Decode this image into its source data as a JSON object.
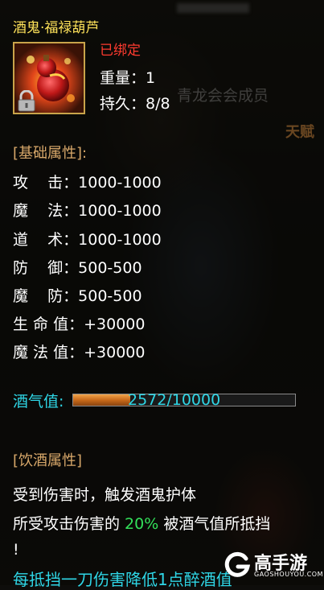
{
  "item": {
    "name": "酒鬼·福禄葫芦",
    "bound_status": "已绑定",
    "weight_label": "重量：",
    "weight_value": "1",
    "durability_label": "持久：",
    "durability_value": "8/8"
  },
  "background_text": {
    "guild_watermark": "青龙会会成员",
    "tianfu": "天赋"
  },
  "base_attributes": {
    "title": "[基础属性]:",
    "rows": [
      {
        "label": "攻    击：",
        "value": "1000-1000"
      },
      {
        "label": "魔    法：",
        "value": "1000-1000"
      },
      {
        "label": "道    术：",
        "value": "1000-1000"
      },
      {
        "label": "防    御：",
        "value": "500-500"
      },
      {
        "label": "魔    防：",
        "value": "500-500"
      },
      {
        "label": "生 命 值：",
        "value": "+30000"
      },
      {
        "label": "魔 法 值：",
        "value": "+30000"
      }
    ]
  },
  "wine": {
    "label": "酒气值:",
    "value_text": "2572/10000",
    "fraction": 0.2572
  },
  "drinking_attributes": {
    "title": "[饮酒属性]",
    "line1": "受到伤害时，触发酒鬼护体",
    "line2_pre": "所受攻击伤害的 ",
    "line2_pct": "20%",
    "line2_post": " 被酒气值所抵挡",
    "line3": "!",
    "line4": "每抵挡一刀伤害降低1点醉酒值"
  },
  "logo": {
    "name": "高手游",
    "site": "GAOSHOUYOU.COM"
  },
  "colors": {
    "title_yellow": "#ffe35a",
    "bound_red": "#ff3b2f",
    "section_tan": "#d8a86a",
    "cyan": "#2fd6e6",
    "green": "#33e05a",
    "frame_gold": "#c9a44a"
  }
}
